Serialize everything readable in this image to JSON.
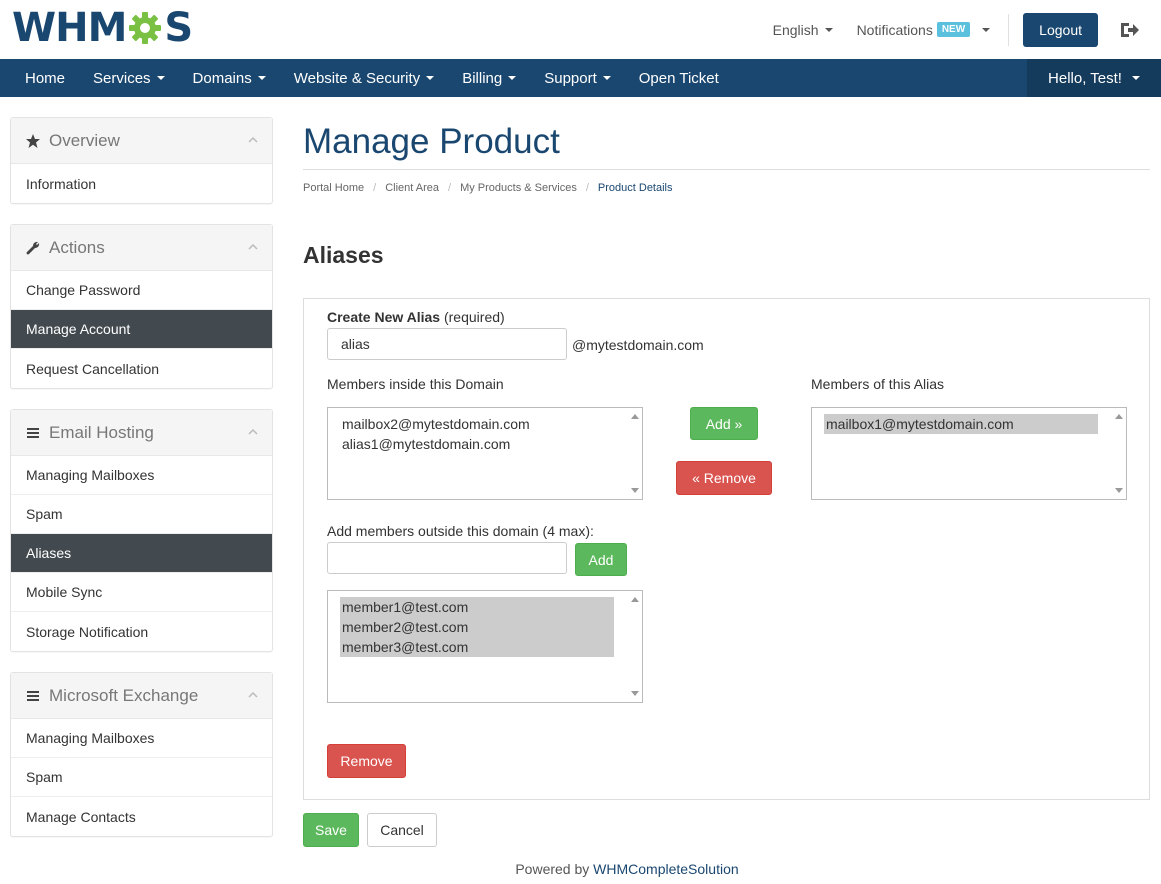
{
  "header": {
    "logo_text_left": "WHM",
    "logo_text_right": "S",
    "language": "English",
    "notifications_label": "Notifications",
    "notifications_badge": "NEW",
    "logout_label": "Logout",
    "brand_color": "#1a4770",
    "accent_color": "#5cb85c"
  },
  "nav": {
    "items": [
      {
        "label": "Home",
        "dropdown": false
      },
      {
        "label": "Services",
        "dropdown": true
      },
      {
        "label": "Domains",
        "dropdown": true
      },
      {
        "label": "Website & Security",
        "dropdown": true
      },
      {
        "label": "Billing",
        "dropdown": true
      },
      {
        "label": "Support",
        "dropdown": true
      },
      {
        "label": "Open Ticket",
        "dropdown": false
      }
    ],
    "user_label": "Hello, Test!"
  },
  "sidebar": {
    "overview": {
      "title": "Overview",
      "icon": "star-icon",
      "items": [
        "Information"
      ]
    },
    "actions": {
      "title": "Actions",
      "icon": "wrench-icon",
      "items": [
        "Change Password",
        "Manage Account",
        "Request Cancellation"
      ],
      "active": "Manage Account"
    },
    "email_hosting": {
      "title": "Email Hosting",
      "icon": "menu-icon",
      "items": [
        "Managing Mailboxes",
        "Spam",
        "Aliases",
        "Mobile Sync",
        "Storage Notification"
      ],
      "active": "Aliases"
    },
    "exchange": {
      "title": "Microsoft Exchange",
      "icon": "menu-icon",
      "items": [
        "Managing Mailboxes",
        "Spam",
        "Manage Contacts"
      ]
    }
  },
  "main": {
    "page_title": "Manage Product",
    "breadcrumb": [
      "Portal Home",
      "Client Area",
      "My Products & Services",
      "Product Details"
    ],
    "section_title": "Aliases",
    "form": {
      "create_label": "Create New Alias",
      "create_required": "(required)",
      "alias_value": "alias",
      "domain_suffix": "@mytestdomain.com",
      "members_inside_label": "Members inside this Domain",
      "members_inside": [
        "mailbox2@mytestdomain.com",
        "alias1@mytestdomain.com"
      ],
      "add_label": "Add »",
      "remove_label": "« Remove",
      "members_alias_label": "Members of this Alias",
      "members_alias": [
        "mailbox1@mytestdomain.com"
      ],
      "outside_label": "Add members outside this domain (4 max):",
      "outside_value": "",
      "outside_add_label": "Add",
      "outside_members": [
        "member1@test.com",
        "member2@test.com",
        "member3@test.com"
      ],
      "outside_remove_label": "Remove"
    },
    "save_label": "Save",
    "cancel_label": "Cancel"
  },
  "footer": {
    "prefix": "Powered by",
    "link": "WHMCompleteSolution"
  }
}
